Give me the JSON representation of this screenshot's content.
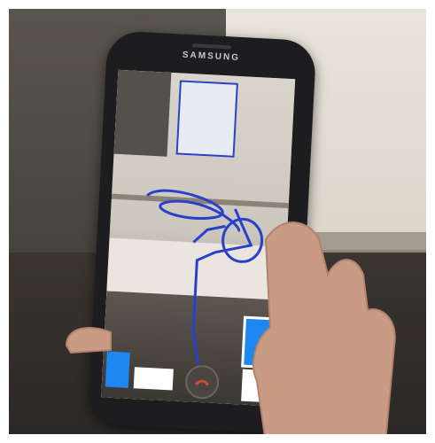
{
  "photo": {
    "phone_brand": "SAMSUNG",
    "screen": {
      "controls": {
        "call_button_icon": "end-call-icon",
        "call_button_color": "#d64a3b",
        "accent_blue": "#1e88f0",
        "drawing_color": "#2a40c9"
      }
    }
  }
}
